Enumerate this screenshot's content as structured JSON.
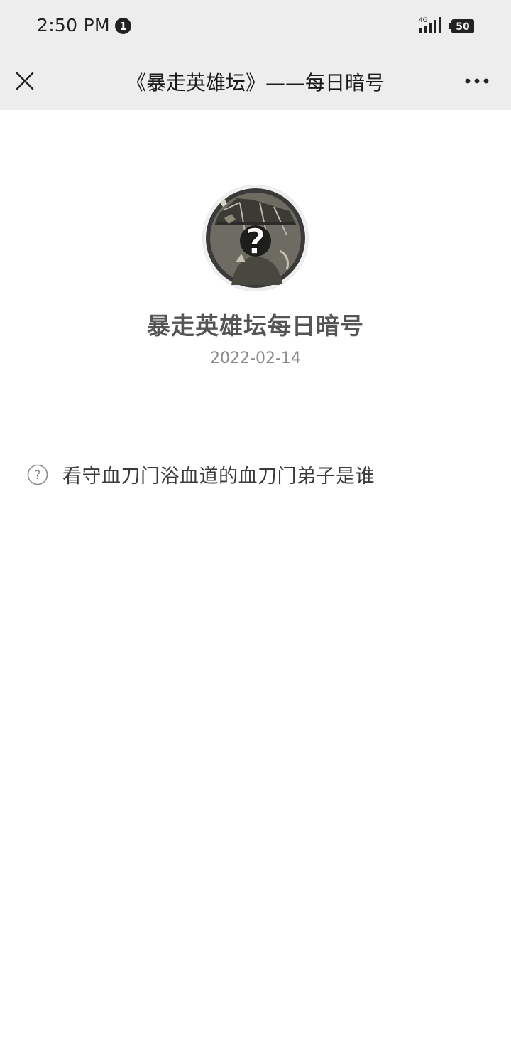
{
  "status_bar": {
    "time": "2:50 PM",
    "notification_count": "1",
    "network": "4G",
    "battery": "50"
  },
  "nav": {
    "title": "《暴走英雄坛》——每日暗号",
    "close_icon": "close-icon",
    "more_icon": "more-icon"
  },
  "article": {
    "avatar_icon": "question-mark-cartoon-avatar",
    "account_name": "暴走英雄坛每日暗号",
    "date": "2022-02-14",
    "question_icon": "question-circle-icon",
    "question": "看守血刀门浴血道的血刀门弟子是谁"
  },
  "colors": {
    "bar_background": "#ededed",
    "page_background": "#ffffff"
  }
}
